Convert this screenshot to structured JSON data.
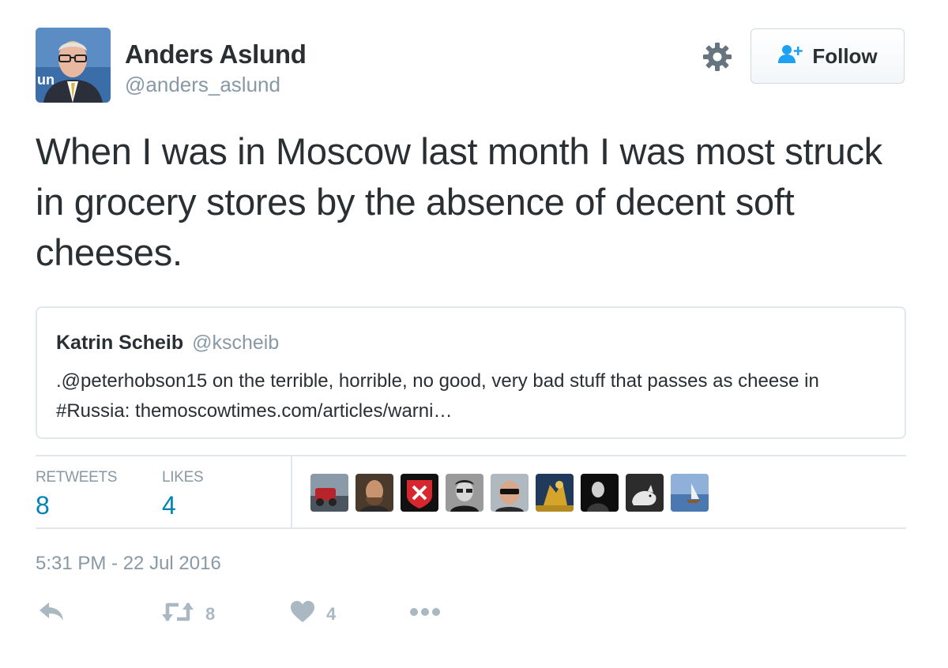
{
  "author": {
    "display_name": "Anders Aslund",
    "screen_name": "@anders_aslund",
    "avatar_banner_text": "un"
  },
  "follow_button": {
    "label": "Follow"
  },
  "tweet": {
    "text": "When I was in Moscow last month I was most struck in grocery stores by the absence of decent soft cheeses.",
    "timestamp": "5:31 PM - 22 Jul 2016"
  },
  "quoted_tweet": {
    "display_name": "Katrin Scheib",
    "screen_name": "@kscheib",
    "text": ".@peterhobson15 on the terrible, horrible, no good, very bad stuff that passes as cheese in #Russia: themoscowtimes.com/articles/warni…"
  },
  "stats": {
    "retweets_label": "RETWEETS",
    "retweets_count": "8",
    "likes_label": "LIKES",
    "likes_count": "4"
  },
  "likers_count_shown": 9,
  "actions": {
    "retweet_count": "8",
    "like_count": "4"
  },
  "colors": {
    "link_blue": "#0084b4",
    "muted_gray": "#8899a6",
    "action_gray": "#aab8c2",
    "text": "#292f33",
    "border": "#e1e8ed"
  }
}
